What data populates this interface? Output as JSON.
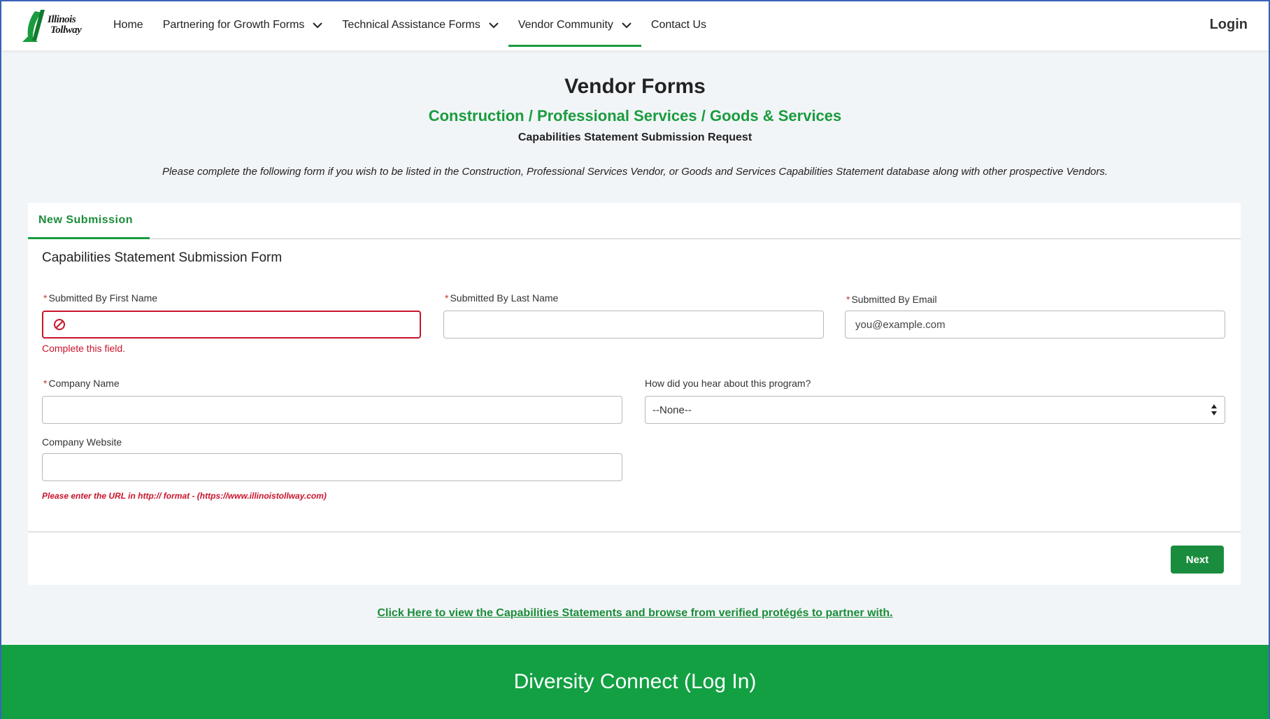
{
  "brand": {
    "line1": "Illinois",
    "line2": "Tollway",
    "green": "#1a9c3e"
  },
  "nav": {
    "items": [
      {
        "label": "Home",
        "dropdown": false
      },
      {
        "label": "Partnering for Growth Forms",
        "dropdown": true
      },
      {
        "label": "Technical Assistance Forms",
        "dropdown": true
      },
      {
        "label": "Vendor Community",
        "dropdown": true,
        "active": true
      },
      {
        "label": "Contact Us",
        "dropdown": false
      }
    ],
    "login_label": "Login"
  },
  "header": {
    "title": "Vendor Forms",
    "subtitle": "Construction / Professional Services / Goods & Services",
    "request": "Capabilities Statement Submission Request",
    "instructions": "Please complete the following form if you wish to be listed in the Construction, Professional Services Vendor, or Goods and Services Capabilities Statement database along with other prospective Vendors."
  },
  "card": {
    "tab_label": "New Submission",
    "form_title": "Capabilities Statement Submission Form",
    "fields": {
      "first_name": {
        "required": "*",
        "label": "Submitted By First Name",
        "value": "",
        "error": "Complete this field."
      },
      "last_name": {
        "required": "*",
        "label": "Submitted By Last Name",
        "value": ""
      },
      "email": {
        "required": "*",
        "label": "Submitted By Email",
        "placeholder": "you@example.com"
      },
      "company": {
        "required": "*",
        "label": "Company Name",
        "value": ""
      },
      "heard": {
        "label": "How did you hear about this program?",
        "selected": "--None--"
      },
      "website": {
        "label": "Company Website",
        "value": ""
      }
    },
    "url_note": "Please enter the URL in http:// format - (https://www.illinoistollway.com)",
    "next_label": "Next"
  },
  "browse_link": "Click Here to view the Capabilities Statements and browse from verified protégés to partner with.",
  "banner_label": "Diversity Connect (Log In)",
  "colors": {
    "error": "#c9142b",
    "button": "#1a8c3d",
    "banner": "#12a043"
  }
}
